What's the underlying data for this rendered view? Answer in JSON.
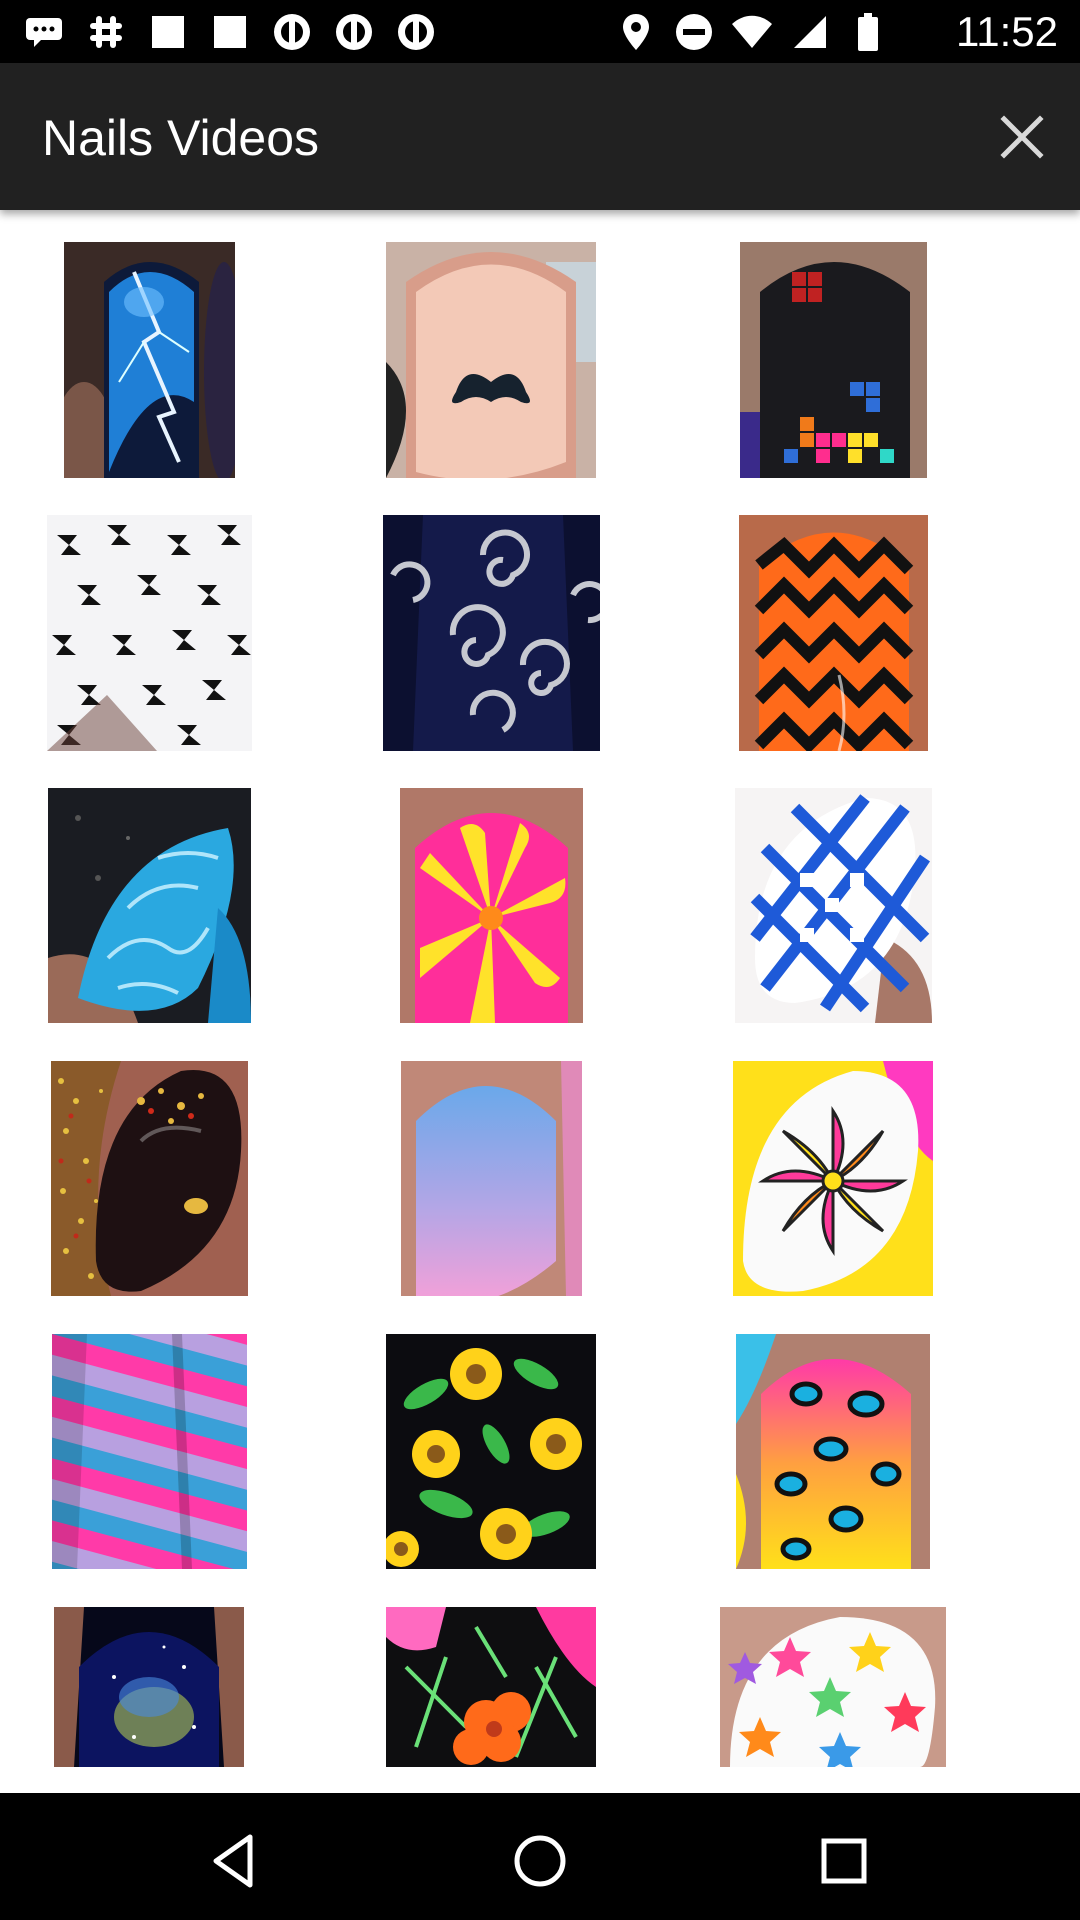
{
  "status_bar": {
    "time": "11:52",
    "left_icons": [
      "message-icon",
      "slack-icon",
      "image-icon",
      "image-icon",
      "signal-icon",
      "signal-icon",
      "signal-icon"
    ],
    "right_icons": [
      "location-icon",
      "do-not-disturb-icon",
      "wifi-icon",
      "cell-signal-icon",
      "battery-icon"
    ]
  },
  "app_bar": {
    "title": "Nails Videos",
    "close_icon": "close-icon"
  },
  "grid": {
    "columns": 3,
    "items": [
      {
        "name": "lightning-blue-nail"
      },
      {
        "name": "mustache-nude-nail"
      },
      {
        "name": "tetris-black-nail"
      },
      {
        "name": "houndstooth-nail"
      },
      {
        "name": "silver-swirl-navy-nail"
      },
      {
        "name": "orange-chevron-nail"
      },
      {
        "name": "turquoise-marble-nail"
      },
      {
        "name": "pink-yellow-water-marble-nail"
      },
      {
        "name": "blue-lattice-nail"
      },
      {
        "name": "gold-glitter-black-nail"
      },
      {
        "name": "blue-pink-gradient-nail"
      },
      {
        "name": "mandala-flower-nail"
      },
      {
        "name": "pink-blue-stripes-nail"
      },
      {
        "name": "sunflower-nail"
      },
      {
        "name": "neon-leopard-nail"
      },
      {
        "name": "galaxy-nail"
      },
      {
        "name": "neon-floral-nail"
      },
      {
        "name": "rainbow-stars-nail"
      }
    ]
  },
  "nav_bar": {
    "back_icon": "back-triangle-icon",
    "home_icon": "home-circle-icon",
    "recents_icon": "recents-square-icon"
  }
}
